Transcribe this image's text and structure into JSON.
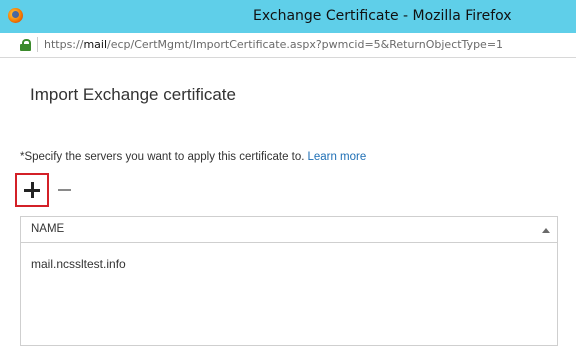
{
  "window": {
    "title": "Exchange Certificate - Mozilla Firefox",
    "browser_icon": "firefox-icon"
  },
  "address_bar": {
    "url_prefix": "https://",
    "url_host": "mail",
    "url_rest": "/ecp/CertMgmt/ImportCertificate.aspx?pwmcid=5&ReturnObjectType=1",
    "secure_icon": "lock-icon",
    "secure_color": "#3b8a2c"
  },
  "dialog": {
    "title": "Import Exchange certificate",
    "instruction": "*Specify the servers you want to apply this certificate to.",
    "learn_more": "Learn more",
    "link_color": "#1e6fb5"
  },
  "toolbar": {
    "add_icon": "plus-icon",
    "remove_icon": "minus-icon",
    "highlight_color": "#d32027"
  },
  "servers_grid": {
    "columns": [
      "NAME"
    ],
    "sort_icon": "sort-ascending-icon",
    "rows": [
      {
        "name": "mail.ncssltest.info"
      }
    ]
  },
  "colors": {
    "titlebar": "#5fcfe9"
  }
}
